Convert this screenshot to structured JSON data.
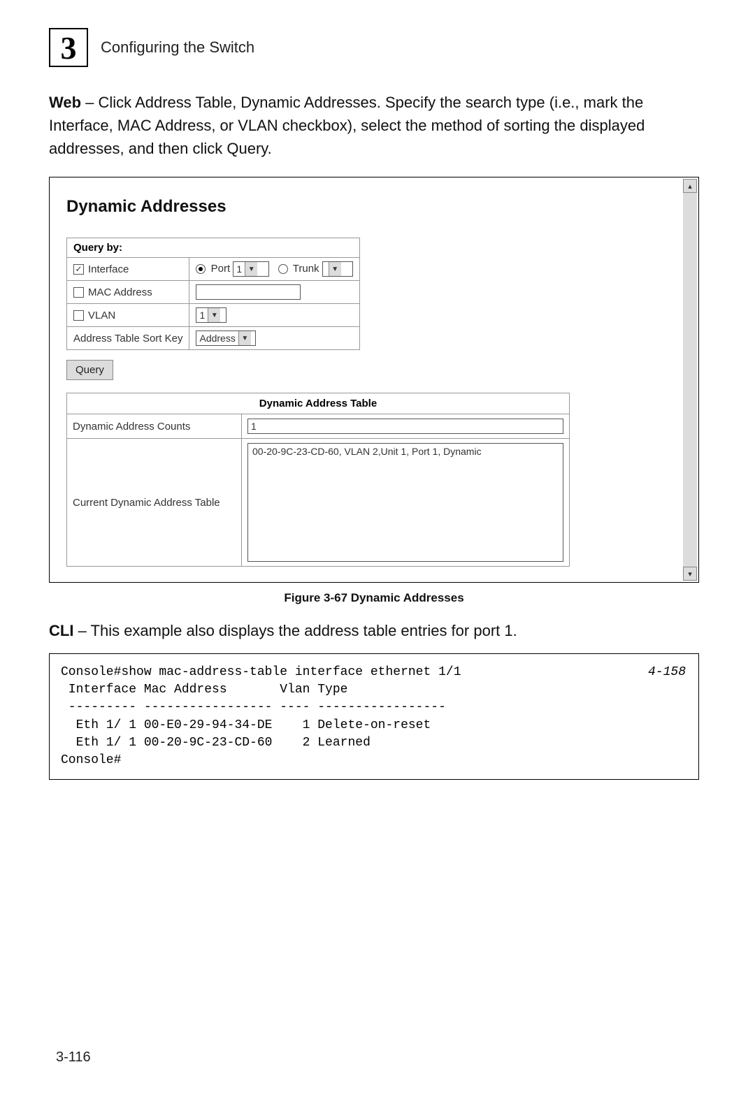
{
  "header": {
    "chapter_number": "3",
    "chapter_title": "Configuring the Switch"
  },
  "web_para": {
    "prefix_bold": "Web",
    "text": " – Click Address Table, Dynamic Addresses. Specify the search type (i.e., mark the Interface, MAC Address, or VLAN checkbox), select the method of sorting the displayed addresses, and then click Query."
  },
  "screenshot": {
    "title": "Dynamic Addresses",
    "query_by_label": "Query by:",
    "interface": {
      "label": "Interface",
      "checked": true,
      "port_label": "Port",
      "port_value": "1",
      "port_radio_selected": true,
      "trunk_label": "Trunk",
      "trunk_value": "",
      "trunk_radio_selected": false
    },
    "mac": {
      "label": "MAC Address",
      "checked": false,
      "value": ""
    },
    "vlan": {
      "label": "VLAN",
      "checked": false,
      "value": "1"
    },
    "sort_key": {
      "label": "Address Table Sort Key",
      "value": "Address"
    },
    "query_button": "Query",
    "addr_table_header": "Dynamic Address Table",
    "counts_label": "Dynamic Address Counts",
    "counts_value": "1",
    "current_label": "Current Dynamic Address Table",
    "current_entry": "00-20-9C-23-CD-60, VLAN 2,Unit 1, Port 1, Dynamic"
  },
  "figure_caption": "Figure 3-67  Dynamic Addresses",
  "cli_para": {
    "prefix_bold": "CLI",
    "text": " – This example also displays the address table entries for port 1."
  },
  "cli": {
    "line1": "Console#show mac-address-table interface ethernet 1/1",
    "ref": "4-158",
    "line2": " Interface Mac Address       Vlan Type",
    "line3": " --------- ----------------- ---- -----------------",
    "line4": "  Eth 1/ 1 00-E0-29-94-34-DE    1 Delete-on-reset",
    "line5": "  Eth 1/ 1 00-20-9C-23-CD-60    2 Learned",
    "line6": "Console#"
  },
  "page_number": "3-116"
}
